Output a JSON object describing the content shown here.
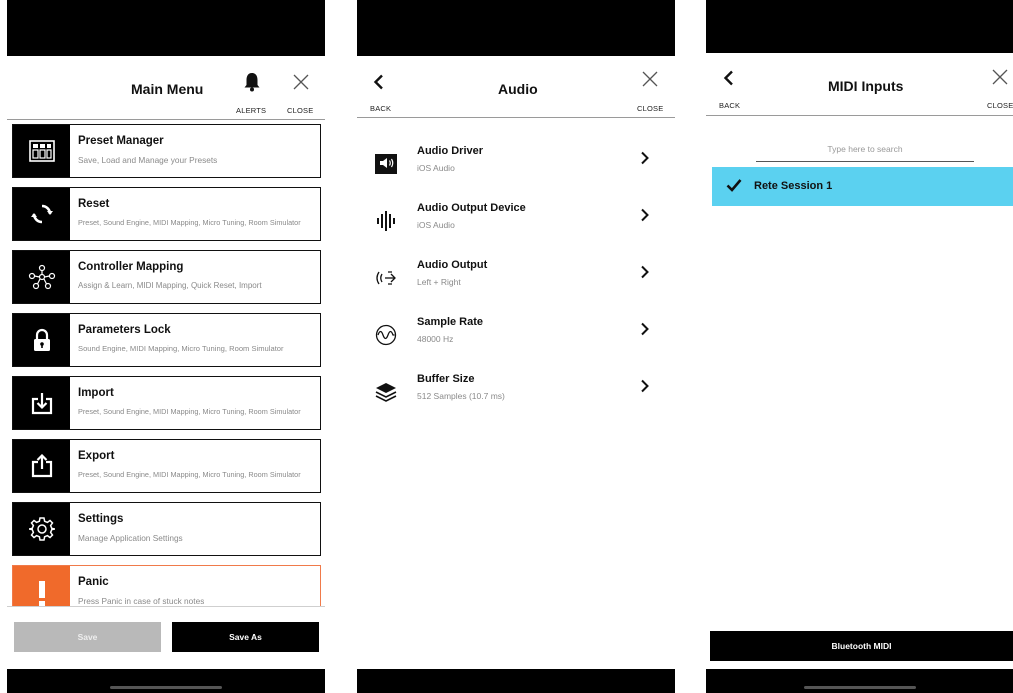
{
  "main_menu": {
    "title": "Main Menu",
    "alerts_label": "ALERTS",
    "close_label": "CLOSE",
    "items": [
      {
        "title": "Preset Manager",
        "subtitle": "Save, Load and Manage your Presets",
        "icon": "preset-grid-icon"
      },
      {
        "title": "Reset",
        "subtitle": "Preset, Sound Engine, MIDI Mapping, Micro Tuning, Room Simulator",
        "icon": "reset-arrows-icon"
      },
      {
        "title": "Controller Mapping",
        "subtitle": "Assign & Learn, MIDI Mapping, Quick Reset, Import",
        "icon": "network-nodes-icon"
      },
      {
        "title": "Parameters Lock",
        "subtitle": "Sound Engine, MIDI Mapping, Micro Tuning, Room Simulator",
        "icon": "lock-icon"
      },
      {
        "title": "Import",
        "subtitle": "Preset, Sound Engine, MIDI Mapping, Micro Tuning, Room Simulator",
        "icon": "import-icon"
      },
      {
        "title": "Export",
        "subtitle": "Preset, Sound Engine, MIDI Mapping, Micro Tuning, Room Simulator",
        "icon": "export-icon"
      },
      {
        "title": "Settings",
        "subtitle": "Manage Application Settings",
        "icon": "gear-icon"
      },
      {
        "title": "Panic",
        "subtitle": "Press Panic in case of stuck notes",
        "icon": "exclamation-icon"
      }
    ],
    "save_label": "Save",
    "save_as_label": "Save As"
  },
  "audio": {
    "title": "Audio",
    "back_label": "BACK",
    "close_label": "CLOSE",
    "rows": [
      {
        "title": "Audio Driver",
        "subtitle": "iOS Audio",
        "icon": "speaker-icon"
      },
      {
        "title": "Audio Output Device",
        "subtitle": "iOS Audio",
        "icon": "waveform-bars-icon"
      },
      {
        "title": "Audio Output",
        "subtitle": "Left + Right",
        "icon": "stereo-output-icon"
      },
      {
        "title": "Sample Rate",
        "subtitle": "48000 Hz",
        "icon": "sine-wave-icon"
      },
      {
        "title": "Buffer Size",
        "subtitle": "512 Samples (10.7 ms)",
        "icon": "layers-icon"
      }
    ]
  },
  "midi": {
    "title": "MIDI Inputs",
    "back_label": "BACK",
    "close_label": "CLOSE",
    "search_placeholder": "Type here to search",
    "inputs": [
      {
        "name": "Rete Session 1",
        "selected": true
      }
    ],
    "bluetooth_label": "Bluetooth MIDI"
  },
  "colors": {
    "panic_accent": "#f06a2b",
    "selection": "#5bd1f0",
    "save_disabled": "#b9b9b9"
  }
}
